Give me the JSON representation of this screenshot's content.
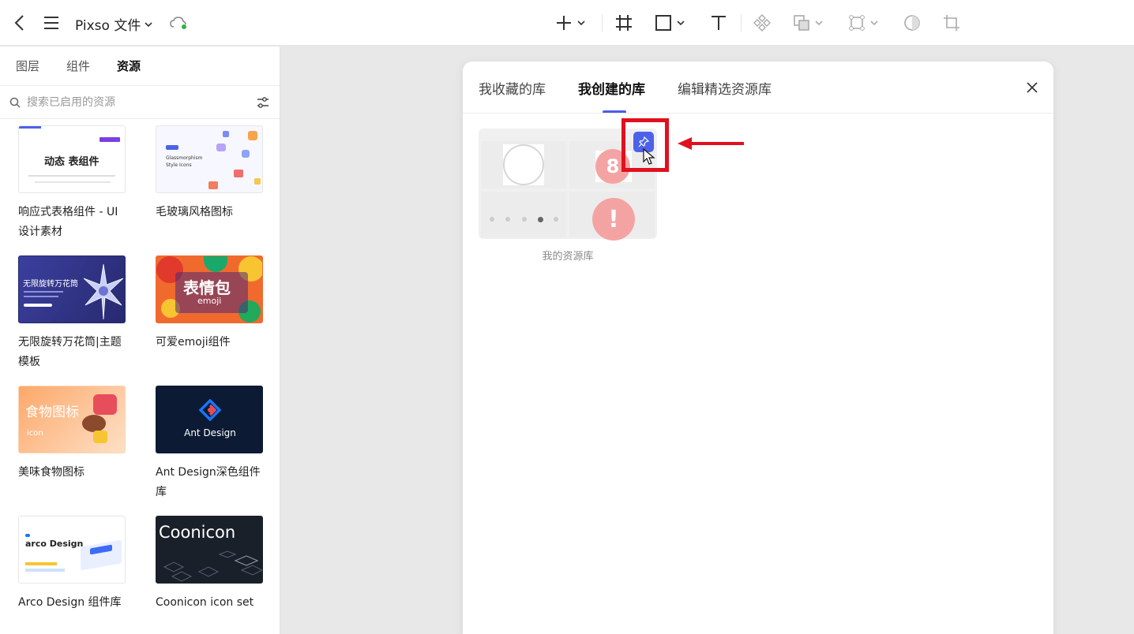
{
  "app": {
    "title": "Pixso 文件",
    "icons": [
      "back-arrow-icon",
      "hamburger-menu-icon",
      "chevron-down-icon",
      "cloud-sync-icon"
    ]
  },
  "toolbar": {
    "tools": [
      "plus-icon",
      "frame-icon",
      "rectangle-icon",
      "text-icon",
      "component-icon",
      "boolean-icon",
      "vector-icon",
      "mask-icon",
      "crop-icon"
    ]
  },
  "left_panel": {
    "tabs": [
      {
        "label": "图层",
        "active": false
      },
      {
        "label": "组件",
        "active": false
      },
      {
        "label": "资源",
        "active": true
      }
    ],
    "search_placeholder": "搜索已启用的资源",
    "resources": [
      {
        "name": "响应式表格组件 - UI设计素材",
        "thumb_text": "动态 表组件",
        "bg": "#ffffff"
      },
      {
        "name": "毛玻璃风格图标",
        "thumb_text": "Glassmorphism Style Icons",
        "bg": "#f7f8ff"
      },
      {
        "name": "无限旋转万花筒|主题模板",
        "thumb_text": "无限旋转万花筒",
        "bg": "#2a2c7e"
      },
      {
        "name": "可爱emoji组件",
        "thumb_text": "表情包",
        "thumb_sub": "emoji",
        "bg": "#f06a2e"
      },
      {
        "name": "美味食物图标",
        "thumb_text": "食物图标",
        "thumb_sub": "icon",
        "bg": "#fdc79a"
      },
      {
        "name": "Ant Design深色组件库",
        "thumb_text": "Ant Design",
        "bg": "#0d1a33"
      },
      {
        "name": "Arco Design 组件库",
        "thumb_text": "arco Design",
        "bg": "#ffffff"
      },
      {
        "name": "Coonicon icon set",
        "thumb_text": "Coonicon",
        "bg": "#1a2029"
      }
    ]
  },
  "modal": {
    "tabs": [
      {
        "label": "我收藏的库",
        "active": false
      },
      {
        "label": "我创建的库",
        "active": true
      },
      {
        "label": "编辑精选资源库",
        "active": false
      }
    ],
    "library": {
      "name": "我的资源库",
      "badge_number": "8",
      "alert_symbol": "!"
    },
    "accent_color": "#4c63e8",
    "highlight_color": "#e0101e"
  }
}
